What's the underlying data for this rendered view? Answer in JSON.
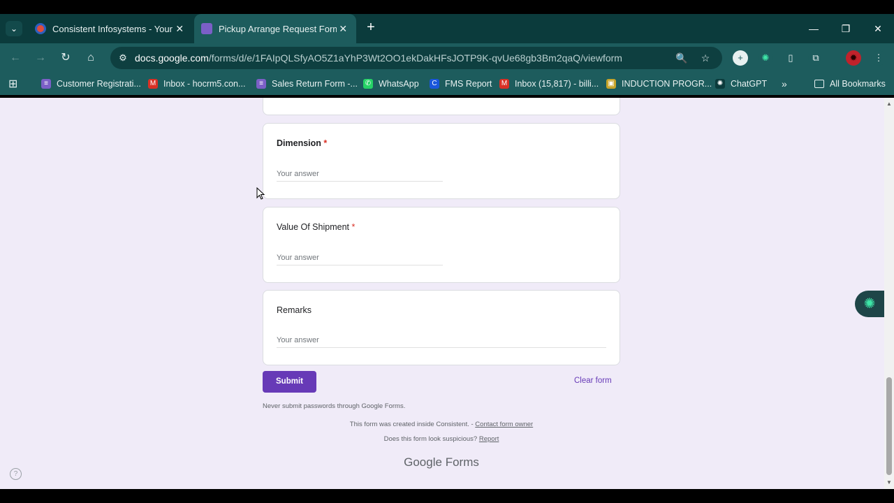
{
  "browser": {
    "tabs": [
      {
        "title": "Consistent Infosystems - Your I",
        "close": "✕",
        "fav_color": "#e04b3c"
      },
      {
        "title": "Pickup Arrange Request Form",
        "close": "✕",
        "fav_color": "#7b5fc7"
      }
    ],
    "new_tab": "+",
    "tab_menu": "⌄",
    "window_controls": {
      "minimize": "—",
      "restore": "❐",
      "close": "✕"
    },
    "nav": {
      "back": "←",
      "forward": "→",
      "reload": "↻",
      "home": "⌂"
    },
    "url_domain": "docs.google.com",
    "url_path": "/forms/d/e/1FAIpQLSfyAO5Z1aYhP3Wt2OO1ekDakHFsJOTP9K-qvUe68gb3Bm2qaQ/viewform",
    "omnibox_icons": {
      "site_info": "⚙",
      "zoom": "🔍",
      "star": "☆"
    },
    "extensions": [
      {
        "name": "add-circle-icon",
        "glyph": "+",
        "color": "#e8f1f1",
        "text": "#1d5c5d"
      },
      {
        "name": "chatgpt-ext-icon",
        "glyph": "✺",
        "color": "#1d5c5d",
        "text": "#3ee6a8"
      },
      {
        "name": "phone-icon",
        "glyph": "▯",
        "color": "#1d5c5d",
        "text": "#e8f1f1"
      },
      {
        "name": "puzzle-icon",
        "glyph": "⧉",
        "color": "#1d5c5d",
        "text": "#e8f1f1"
      },
      {
        "name": "profile-avatar",
        "glyph": "✹",
        "color": "#c0222b",
        "text": "#2a0000"
      },
      {
        "name": "menu-dots-icon",
        "glyph": "⋮",
        "color": "#1d5c5d",
        "text": "#e8f1f1"
      }
    ],
    "bookmarks": [
      {
        "label": "Customer Registrati...",
        "icon": "≡",
        "color": "#7b5fc7"
      },
      {
        "label": "Inbox - hocrm5.con...",
        "icon": "M",
        "color": "#d93025"
      },
      {
        "label": "Sales Return Form -...",
        "icon": "≡",
        "color": "#7b5fc7"
      },
      {
        "label": "WhatsApp",
        "icon": "✆",
        "color": "#25d366"
      },
      {
        "label": "FMS Report",
        "icon": "C",
        "color": "#1a56db"
      },
      {
        "label": "Inbox (15,817) - billi...",
        "icon": "M",
        "color": "#d93025"
      },
      {
        "label": "INDUCTION PROGR...",
        "icon": "▣",
        "color": "#c7a42a"
      },
      {
        "label": "ChatGPT",
        "icon": "✺",
        "color": "#0b3b3c"
      }
    ],
    "bookmarks_overflow": "»",
    "all_bookmarks": "All Bookmarks",
    "apps_icon": "⊞"
  },
  "form": {
    "questions": [
      {
        "label": "Dimension",
        "required": "*",
        "placeholder": "Your answer"
      },
      {
        "label": "Value Of Shipment",
        "required": "*",
        "placeholder": "Your answer"
      },
      {
        "label": "Remarks",
        "required": "",
        "placeholder": "Your answer"
      }
    ],
    "submit_label": "Submit",
    "clear_label": "Clear form",
    "never_submit": "Never submit passwords through Google Forms.",
    "created_text": "This form was created inside Consistent. - ",
    "contact_link": "Contact form owner",
    "suspicious_text": "Does this form look suspicious? ",
    "report_link": "Report",
    "brand_google": "Google",
    "brand_forms": "Forms",
    "help_glyph": "?",
    "floating_glyph": "✺"
  },
  "colors": {
    "chrome_dark": "#0b3b3c",
    "chrome_toolbar": "#1d5c5d",
    "forms_purple": "#673ab7",
    "page_bg": "#f0ebf8",
    "required_red": "#d93025"
  }
}
